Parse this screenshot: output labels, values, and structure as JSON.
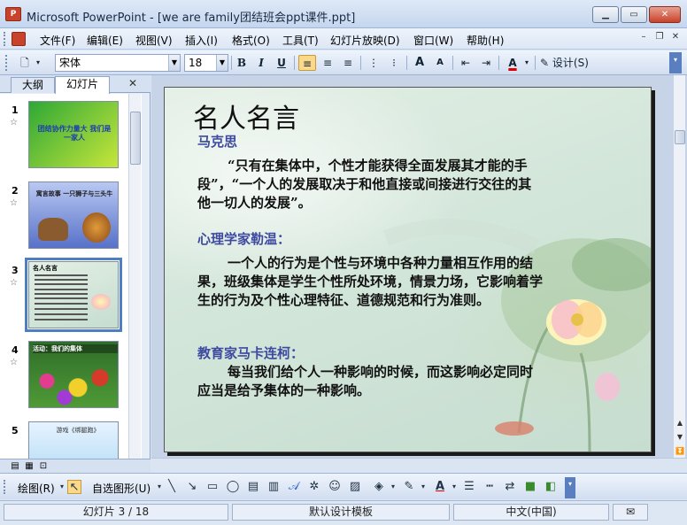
{
  "window": {
    "title": "Microsoft PowerPoint - [we are family团结班会ppt课件.ppt]",
    "app_icon_letter": "P"
  },
  "menu": {
    "items": [
      "文件(F)",
      "编辑(E)",
      "视图(V)",
      "插入(I)",
      "格式(O)",
      "工具(T)",
      "幻灯片放映(D)",
      "窗口(W)",
      "帮助(H)"
    ]
  },
  "toolbar": {
    "font_name": "宋体",
    "font_size": "18",
    "bold_label": "B",
    "italic_label": "I",
    "underline_label": "U",
    "increase_font_label": "A",
    "decrease_font_label": "A",
    "font_color_label": "A",
    "design_label": "设计(S)"
  },
  "left_pane": {
    "tabs": [
      "大纲",
      "幻灯片"
    ],
    "active_tab": "幻灯片",
    "thumbnails": [
      {
        "number": "1",
        "text": "团结协作力量大 我们是一家人"
      },
      {
        "number": "2",
        "text": "寓言故事 一只狮子与三头牛"
      },
      {
        "number": "3",
        "text": "名人名言"
      },
      {
        "number": "4",
        "text": "活动：我们的集体"
      },
      {
        "number": "5",
        "text": "游戏《绑腿跑》"
      }
    ],
    "selected_index": 3
  },
  "slide": {
    "title": "名人名言",
    "sections": [
      {
        "heading": "马克思",
        "body": "“只有在集体中，个性才能获得全面发展其才能的手段”，“一个人的发展取决于和他直接或间接进行交往的其他一切人的发展”。"
      },
      {
        "heading": "心理学家勒温：",
        "body": "一个人的行为是个性与环境中各种力量相互作用的结果，班级集体是学生个性所处环境，情景力场，它影响着学生的行为及个性心理特征、道德规范和行为准则。"
      },
      {
        "heading": "教育家马卡连柯：",
        "body": "每当我们给个人一种影响的时候，而这影响必定同时应当是给予集体的一种影响。"
      }
    ]
  },
  "drawing_toolbar": {
    "draw_label": "绘图(R)",
    "autoshapes_label": "自选图形(U)"
  },
  "status": {
    "slide_info": "幻灯片 3 / 18",
    "template": "默认设计模板",
    "language": "中文(中国)"
  }
}
